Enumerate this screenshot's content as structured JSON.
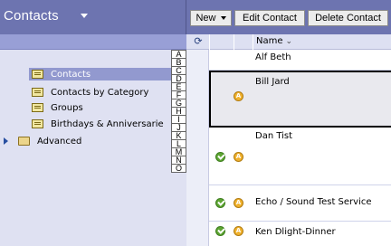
{
  "header": {
    "title": "Contacts"
  },
  "toolbar": {
    "new_label": "New",
    "edit_label": "Edit Contact",
    "delete_label": "Delete Contact"
  },
  "folders": [
    {
      "label": "Contacts",
      "icon": "address-book-icon",
      "selected": true
    },
    {
      "label": "Contacts by Category",
      "icon": "address-book-icon",
      "selected": false
    },
    {
      "label": "Groups",
      "icon": "address-book-icon",
      "selected": false
    },
    {
      "label": "Birthdays & Anniversarie",
      "icon": "address-book-icon",
      "selected": false
    },
    {
      "label": "Advanced",
      "icon": "folder-icon",
      "selected": false,
      "expandable": true
    }
  ],
  "alpha_index": [
    "A",
    "B",
    "C",
    "D",
    "E",
    "F",
    "G",
    "H",
    "I",
    "J",
    "K",
    "L",
    "M",
    "N",
    "O"
  ],
  "list": {
    "name_column": "Name",
    "badge_letter": "A",
    "rows": [
      {
        "name": "Alf Beth",
        "check": false,
        "alert": false
      },
      {
        "name": "Bill Jard",
        "check": false,
        "alert": true,
        "selected": true
      },
      {
        "name": "Dan Tist",
        "check": true,
        "alert": true
      },
      {
        "name": "Echo / Sound Test Service",
        "check": true,
        "alert": true
      },
      {
        "name": "Ken Dlight-Dinner",
        "check": true,
        "alert": true
      }
    ]
  },
  "colors": {
    "header_bg": "#6d74b0",
    "selection_bg": "#9299cf",
    "folder_bg": "#dfe1f2"
  }
}
